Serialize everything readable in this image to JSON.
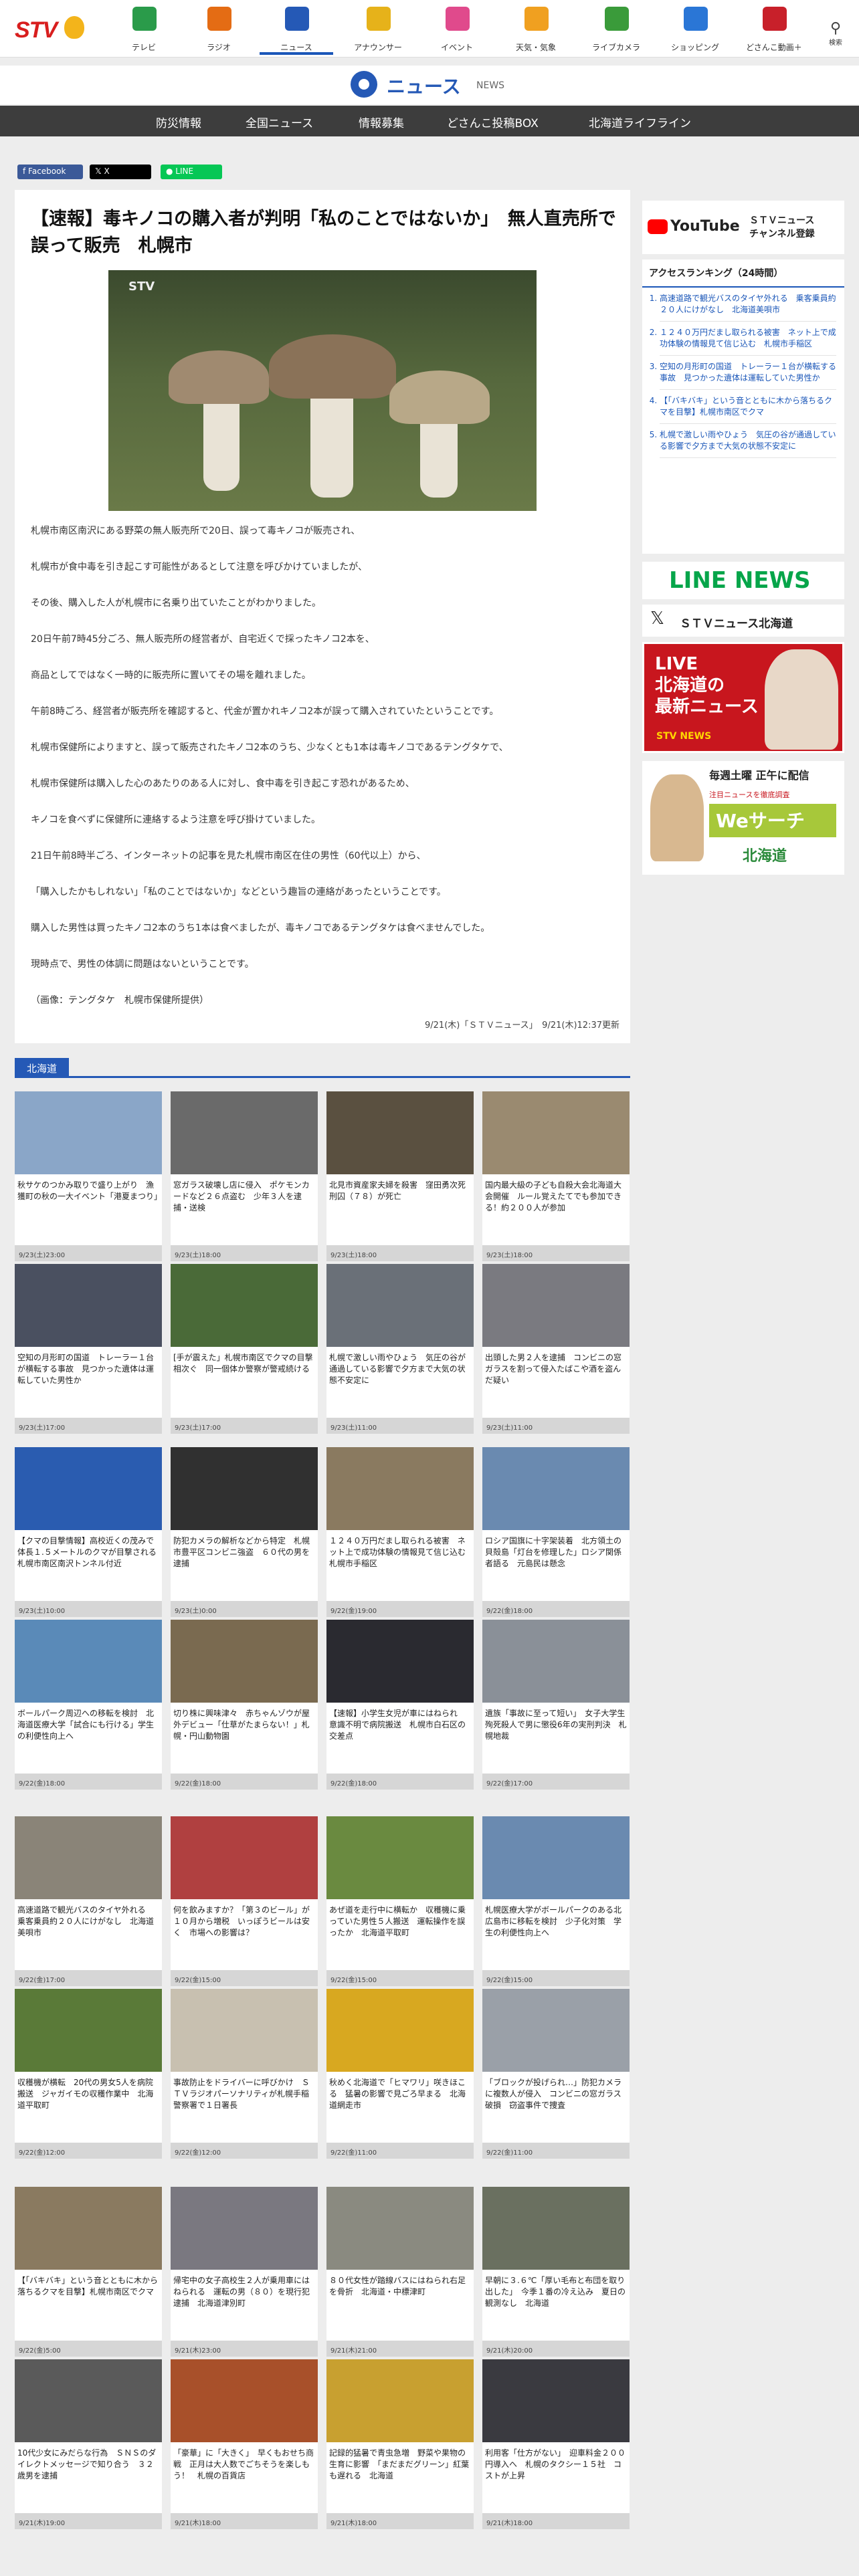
{
  "nav": {
    "items": [
      {
        "label": "テレビ",
        "color": "#2a9b4a"
      },
      {
        "label": "ラジオ",
        "color": "#e46c14"
      },
      {
        "label": "ニュース",
        "color": "#2559b6"
      },
      {
        "label": "アナウンサー",
        "color": "#e6b21a"
      },
      {
        "label": "イベント",
        "color": "#e04a8c"
      },
      {
        "label": "天気・気象",
        "color": "#f0a020"
      },
      {
        "label": "ライブカメラ",
        "color": "#3a9b3a"
      },
      {
        "label": "ショッピング",
        "color": "#2a76d6"
      },
      {
        "label": "どさんこ動画＋",
        "color": "#c8202a"
      }
    ],
    "search_label": "検索"
  },
  "newsbar": {
    "title": "ニュース",
    "subtitle": "NEWS"
  },
  "subnav": [
    "防災情報",
    "全国ニュース",
    "情報募集",
    "どさんこ投稿BOX",
    "北海道ライフライン"
  ],
  "share": [
    "Facebook",
    "X",
    "LINE"
  ],
  "article": {
    "title": "【速報】毒キノコの購入者が判明「私のことではないか」　無人直売所で誤って販売　札幌市",
    "photo_watermark": "STV",
    "paragraphs": [
      "札幌市南区南沢にある野菜の無人販売所で20日、誤って毒キノコが販売され、",
      "札幌市が食中毒を引き起こす可能性があるとして注意を呼びかけていましたが、",
      "その後、購入した人が札幌市に名乗り出ていたことがわかりました。",
      "20日午前7時45分ごろ、無人販売所の経営者が、自宅近くで採ったキノコ2本を、",
      "商品としてではなく一時的に販売所に置いてその場を離れました。",
      "午前8時ごろ、経営者が販売所を確認すると、代金が置かれキノコ2本が誤って購入されていたということです。",
      "札幌市保健所によりますと、誤って販売されたキノコ2本のうち、少なくとも1本は毒キノコであるテングタケで、",
      "札幌市保健所は購入した心のあたりのある人に対し、食中毒を引き起こす恐れがあるため、",
      "キノコを食べずに保健所に連絡するよう注意を呼び掛けていました。",
      "21日午前8時半ごろ、インターネットの記事を見た札幌市南区在住の男性（60代以上）から、",
      "「購入したかもしれない」「私のことではないか」などという趣旨の連絡があったということです。",
      "購入した男性は買ったキノコ2本のうち1本は食べましたが、毒キノコであるテングタケは食べませんでした。",
      "現時点で、男性の体調に問題はないということです。",
      "（画像：テングタケ　札幌市保健所提供）"
    ],
    "meta": "9/21(木)「ＳＴＶニュース」　9/21(木)12:37更新"
  },
  "sidebar": {
    "youtube_label": "YouTube",
    "youtube_text": "ＳＴＶニュース\nチャンネル登録",
    "ranking_title": "アクセスランキング（24時間）",
    "ranking": [
      "高速道路で観光バスのタイヤ外れる　乗客乗員約２０人にけがなし　北海道美唄市",
      "１２４０万円だまし取られる被害　ネット上で成功体験の情報見て信じ込む　札幌市手稲区",
      "空知の月形町の国道　トレーラー１台が横転する事故　見つかった遺体は運転していた男性か",
      "【「バキバキ」という音とともに木から落ちるクマを目撃】札幌市南区でクマ",
      "札幌で激しい雨やひょう　気圧の谷が通過している影響で夕方まで大気の状態不安定に"
    ],
    "line_news": "LINE NEWS",
    "x_account": "ＳＴＶニュース北海道",
    "live_banner": "LIVE\n北海道の\n最新ニュース",
    "live_sub": "STV NEWS",
    "wesearch_top": "毎週土曜 正午に配信",
    "wesearch_mid": "注目ニュースを徹底調査",
    "wesearch_title": "Weサーチ",
    "wesearch_sub": "北海道"
  },
  "section": {
    "title": "北海道"
  },
  "cards": [
    {
      "title": "秋サケのつかみ取りで盛り上がり　漁獲町の秋の一大イベント「港夏まつり」",
      "date": "9/23(土)23:00",
      "color": "#8aa6c8"
    },
    {
      "title": "窓ガラス破壊し店に侵入　ポケモンカードなど２６点盗む　少年３人を逮捕・送検",
      "date": "9/23(土)18:00",
      "color": "#6a6a6a"
    },
    {
      "title": "北見市資産家夫婦を殺害　窪田勇次死刑囚（７８）が死亡",
      "date": "9/23(土)18:00",
      "color": "#5a5040"
    },
    {
      "title": "国内最大級の子ども自殺大会北海道大会開催　ルール覚えたてでも参加できる！約２００人が参加",
      "date": "9/23(土)18:00",
      "color": "#9a8a70"
    },
    {
      "title": "空知の月形町の国道　トレーラー１台が横転する事故　見つかった遺体は運転していた男性か",
      "date": "9/23(土)17:00",
      "color": "#4a5060"
    },
    {
      "title": "[手が震えた」札幌市南区でクマの目撃相次ぐ　同一個体か警察が警戒続ける",
      "date": "9/23(土)17:00",
      "color": "#4a6a38"
    },
    {
      "title": "札幌で激しい雨やひょう　気圧の谷が通過している影響で夕方まで大気の状態不安定に",
      "date": "9/23(土)11:00",
      "color": "#6a7078"
    },
    {
      "title": "出頭した男２人を逮捕　コンビニの窓ガラスを割って侵入たばこや酒を盗んだ疑い",
      "date": "9/23(土)11:00",
      "color": "#7a7a80"
    },
    {
      "title": "【クマの目撃情報】高校近くの茂みで体長１.５メートルのクマが目撃される　札幌市南区南沢トンネル付近",
      "date": "9/23(土)10:00",
      "color": "#2a5cb0"
    },
    {
      "title": "防犯カメラの解析などから特定　札幌市豊平区コンビニ強盗　６０代の男を逮捕",
      "date": "9/23(土)0:00",
      "color": "#303030"
    },
    {
      "title": "１２４０万円だまし取られる被害　ネット上で成功体験の情報見て信じ込む　札幌市手稲区",
      "date": "9/22(金)19:00",
      "color": "#8a7a60"
    },
    {
      "title": "ロシア国旗に十字架装着　北方領土の貝殻島「灯台を修理した」ロシア関係者語る　元島民は懸念",
      "date": "9/22(金)18:00",
      "color": "#6a8ab0"
    },
    {
      "title": "ボールパーク周辺への移転を検討　北海道医療大学「試合にも行ける」学生の利便性向上へ",
      "date": "9/22(金)18:00",
      "color": "#5a8ab8"
    },
    {
      "title": "切り株に興味津々　赤ちゃんゾウが屋外デビュー「仕草がたまらない！」札幌・円山動物園",
      "date": "9/22(金)18:00",
      "color": "#7a6a50"
    },
    {
      "title": "【速報】小学生女児が車にはねられ　意識不明で病院搬送　札幌市白石区の交差点",
      "date": "9/22(金)18:00",
      "color": "#2a2a30"
    },
    {
      "title": "遺族「事故に至って短い」　女子大学生殉死殺人で男に懲役6年の実刑判決　札幌地裁",
      "date": "9/22(金)17:00",
      "color": "#8a9098"
    },
    {
      "title": "高速道路で観光バスのタイヤ外れる　乗客乗員約２０人にけがなし　北海道美唄市",
      "date": "9/22(金)17:00",
      "color": "#8a8478"
    },
    {
      "title": "何を飲みますか？「第３のビール」が１０月から増税　いっぽうビールは安く　市場への影響は？",
      "date": "9/22(金)15:00",
      "color": "#b04040"
    },
    {
      "title": "あぜ道を走行中に横転か　収穫機に乗っていた男性５人搬送　運転操作を誤ったか　北海道平取町",
      "date": "9/22(金)15:00",
      "color": "#6a8a40"
    },
    {
      "title": "札幌医療大学がボールパークのある北広島市に移転を検討　少子化対策　学生の利便性向上へ",
      "date": "9/22(金)15:00",
      "color": "#6a8ab0"
    },
    {
      "title": "収穫機が横転　20代の男女5人を病院搬送　ジャガイモの収穫作業中　北海道平取町",
      "date": "9/22(金)12:00",
      "color": "#5a7a38"
    },
    {
      "title": "事故防止をドライバーに呼びかけ　ＳＴＶラジオパーソナリティが札幌手稲警察署で１日署長",
      "date": "9/22(金)12:00",
      "color": "#c8c0b0"
    },
    {
      "title": "秋めく北海道で「ヒマワリ」咲きほこる　猛暑の影響で見ごろ早まる　北海道網走市",
      "date": "9/22(金)11:00",
      "color": "#d8a820"
    },
    {
      "title": "「ブロックが投げられ…」防犯カメラに複数人が侵入　コンビニの窓ガラス破損　窃盗事件で捜査",
      "date": "9/22(金)11:00",
      "color": "#9aa0a8"
    },
    {
      "title": "【「バキバキ」という音とともに木から落ちるクマを目撃】札幌市南区でクマ",
      "date": "9/22(金)5:00",
      "color": "#8a7a60"
    },
    {
      "title": "帰宅中の女子高校生２人が乗用車にはねられる　運転の男（８０）を現行犯逮捕　北海道津別町",
      "date": "9/21(木)23:00",
      "color": "#7a7880"
    },
    {
      "title": "８０代女性が踏線バスにはねられ右足を骨折　北海道・中標津町",
      "date": "9/21(木)21:00",
      "color": "#8a8a80"
    },
    {
      "title": "早朝に３.６℃「厚い毛布と布団を取り出した」　今季１番の冷え込み　夏日の観測なし　北海道",
      "date": "9/21(木)20:00",
      "color": "#6a7060"
    },
    {
      "title": "10代少女にみだらな行為　ＳＮＳのダイレクトメッセージで知り合う　３２歳男を逮捕",
      "date": "9/21(木)19:00",
      "color": "#5a5a5a"
    },
    {
      "title": "「豪華」に「大きく」　早くもおせち商戦　正月は大人数でごちそうを楽しもう！　札幌の百貨店",
      "date": "9/21(木)18:00",
      "color": "#a8502a"
    },
    {
      "title": "記録的猛暑で青虫急増　野菜や果物の生育に影響　「まだまだグリーン」紅葉も遅れる　北海道",
      "date": "9/21(木)18:00",
      "color": "#c8a030"
    },
    {
      "title": "利用客「仕方がない」　迎車料金２００円導入へ　札幌のタクシー１５社　コストが上昇",
      "date": "9/21(木)18:00",
      "color": "#3a3a40"
    }
  ]
}
